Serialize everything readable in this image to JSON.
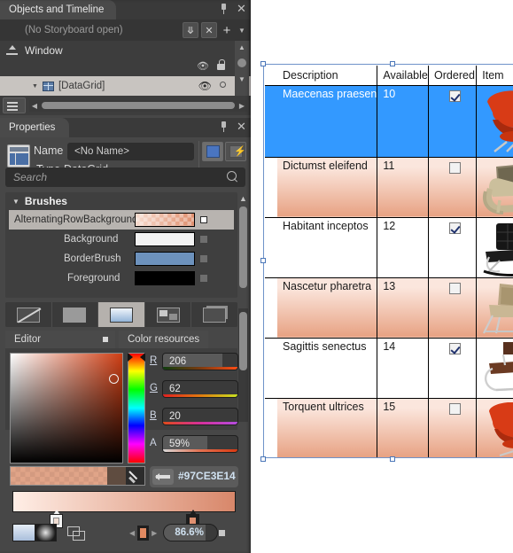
{
  "app": {
    "accent_blue": "#3399ff",
    "selection_border": "#6f93c9",
    "panel_bg": "#474747"
  },
  "objects_panel": {
    "tab_label": "Objects and Timeline",
    "pin_icon": "pin-icon",
    "close_icon": "close-icon",
    "storyboard_text": "(No Storyboard open)",
    "collapse_icon": "double-chevron-down-icon",
    "close_storyboard_icon": "close-x-icon",
    "add_icon": "plus-icon",
    "dropdown_icon": "chevron-down-icon",
    "tree": {
      "root_label": "Window",
      "root_icon": "artboard-icon",
      "eye_icon": "eye-icon",
      "lock_icon": "lock-icon",
      "item_label": "[DataGrid]",
      "item_icon": "datagrid-icon",
      "item_expander": "triangle-down-icon",
      "item_eye_icon": "eye-icon",
      "item_lock_icon": "unlock-circle-icon"
    },
    "layers_button_icon": "layers-icon",
    "hscroll_left_icon": "arrow-left-icon",
    "hscroll_right_icon": "arrow-right-icon",
    "vscroll_up_icon": "arrow-up-icon",
    "vscroll_down_icon": "arrow-down-icon"
  },
  "properties_panel": {
    "tab_label": "Properties",
    "pin_icon": "pin-icon",
    "close_icon": "close-icon",
    "element_icon": "datagrid-icon",
    "name_label": "Name",
    "name_value": "<No Name>",
    "type_label": "Type",
    "type_value": "DataGrid",
    "properties_toggle_icon": "properties-view-icon",
    "events_toggle_icon": "events-view-icon",
    "search_placeholder": "Search",
    "search_icon": "search-icon",
    "brushes": {
      "section_title": "Brushes",
      "expander_icon": "triangle-down-icon",
      "rows": [
        {
          "label": "AlternatingRowBackground",
          "swatch": "gradient-peach",
          "selected": true,
          "mark": "advanced-options-icon"
        },
        {
          "label": "Background",
          "swatch": "#f2f2f2",
          "selected": false,
          "mark": "advanced-options-icon"
        },
        {
          "label": "BorderBrush",
          "swatch": "#6d92bd",
          "selected": false,
          "mark": "advanced-options-icon"
        },
        {
          "label": "Foreground",
          "swatch": "#000000",
          "selected": false,
          "mark": "advanced-options-icon"
        }
      ]
    },
    "brush_types": [
      {
        "name": "no-brush",
        "icon": "no-brush-icon",
        "active": false
      },
      {
        "name": "solid-color-brush",
        "icon": "solid-color-brush-icon",
        "active": false
      },
      {
        "name": "gradient-brush",
        "icon": "gradient-brush-icon",
        "active": true
      },
      {
        "name": "tile-brush",
        "icon": "tile-brush-icon",
        "active": false
      },
      {
        "name": "brush-resources",
        "icon": "brush-resources-icon",
        "active": false
      }
    ],
    "editor_tabs": [
      {
        "label": "Editor",
        "active": true,
        "mini_icon": "square-icon"
      },
      {
        "label": "Color resources",
        "active": false,
        "mini_icon": ""
      }
    ],
    "color_editor": {
      "sv_picker_name": "saturation-value-picker",
      "hue_slider_name": "hue-slider",
      "eyedropper_icon": "eyedropper-icon",
      "swap_icon": "swap-colors-icon",
      "hex_value": "#97CE3E14",
      "channels": [
        {
          "label": "R",
          "value": "206",
          "fill_pct": 80,
          "gradient": "linear-gradient(to right,#0d3d0d,#7a3a10,#ff4d14)"
        },
        {
          "label": "G",
          "value": "62",
          "fill_pct": 24,
          "gradient": "linear-gradient(to right,#e02020,#e07a10,#c8e020)"
        },
        {
          "label": "B",
          "value": "20",
          "fill_pct": 8,
          "gradient": "linear-gradient(to right,#e04a1a,#d6309a,#b44ce0)"
        },
        {
          "label": "A",
          "value": "59%",
          "fill_pct": 59,
          "gradient": "linear-gradient(to right,#d8d8d8,#e27050,#d93a12)"
        }
      ]
    },
    "gradient_bar": {
      "name": "gradient-stop-bar",
      "stops": [
        {
          "position_pct": 26,
          "color": "#f6e2d6",
          "kind": "light"
        },
        {
          "position_pct": 88,
          "color": "#dd9070",
          "kind": "dark"
        }
      ]
    },
    "bottom_bar": {
      "linear_gradient_icon": "linear-gradient-icon",
      "radial_gradient_icon": "radial-gradient-icon",
      "reverse_stops_icon": "reverse-gradient-stops-icon",
      "stop_prev_icon": "arrow-left-icon",
      "stop_next_icon": "arrow-right-icon",
      "stop_marker_icon": "gradient-stop-icon",
      "offset_value": "86.6%",
      "advanced_icon": "advanced-options-icon"
    }
  },
  "datagrid": {
    "name": "datagrid-design-surface",
    "columns": [
      "Description",
      "Available",
      "Ordered",
      "Item"
    ],
    "rows": [
      {
        "description": "Maecenas praesen",
        "available": "10",
        "ordered": true,
        "item": "red-swan-chair",
        "state": "selected"
      },
      {
        "description": "Dictumst eleifend",
        "available": "11",
        "ordered": false,
        "item": "wood-arm-chair",
        "state": "alternating"
      },
      {
        "description": "Habitant inceptos",
        "available": "12",
        "ordered": true,
        "item": "black-barcelona-chair",
        "state": "normal"
      },
      {
        "description": "Nascetur pharetra",
        "available": "13",
        "ordered": false,
        "item": "tan-lounge-chair",
        "state": "alternating"
      },
      {
        "description": "Sagittis senectus ",
        "available": "14",
        "ordered": true,
        "item": "brown-cantilever-chair",
        "state": "normal"
      },
      {
        "description": "Torquent ultrices",
        "available": "15",
        "ordered": false,
        "item": "red-swivel-chair",
        "state": "alternating"
      }
    ]
  }
}
